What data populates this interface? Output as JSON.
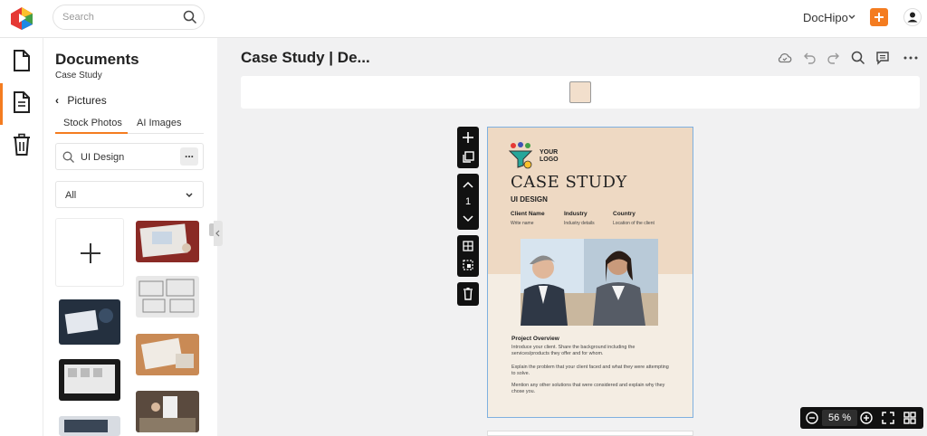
{
  "topbar": {
    "search_placeholder": "Search",
    "brand": "DocHipo",
    "accent": "#f47c20"
  },
  "sidebar_rail": {
    "items": [
      "documents-icon",
      "page-icon",
      "trash-icon"
    ],
    "active_index": 1
  },
  "panel": {
    "title": "Documents",
    "subtitle": "Case Study",
    "back_label": "Pictures",
    "tabs": [
      "Stock Photos",
      "AI Images"
    ],
    "active_tab": 0,
    "search_value": "UI Design",
    "more_label": "...",
    "filter_value": "All"
  },
  "editor": {
    "doc_title": "Case Study | De...",
    "page_number": "1",
    "zoom": "56",
    "zoom_unit": "%"
  },
  "canvas": {
    "logo_text_1": "YOUR",
    "logo_text_2": "LOGO",
    "title": "CASE STUDY",
    "subtitle": "UI DESIGN",
    "meta": [
      {
        "label": "Client Name",
        "value": "Write name"
      },
      {
        "label": "Industry",
        "value": "Industry details"
      },
      {
        "label": "Country",
        "value": "Location of the client"
      }
    ],
    "overview_title": "Project Overview",
    "paragraphs": [
      "Introduce your client. Share the background including the services/products they offer and for whom.",
      "Explain the problem that your client faced and what they were attempting to solve.",
      "Mention any other solutions that were considered and explain why they chose you."
    ]
  }
}
